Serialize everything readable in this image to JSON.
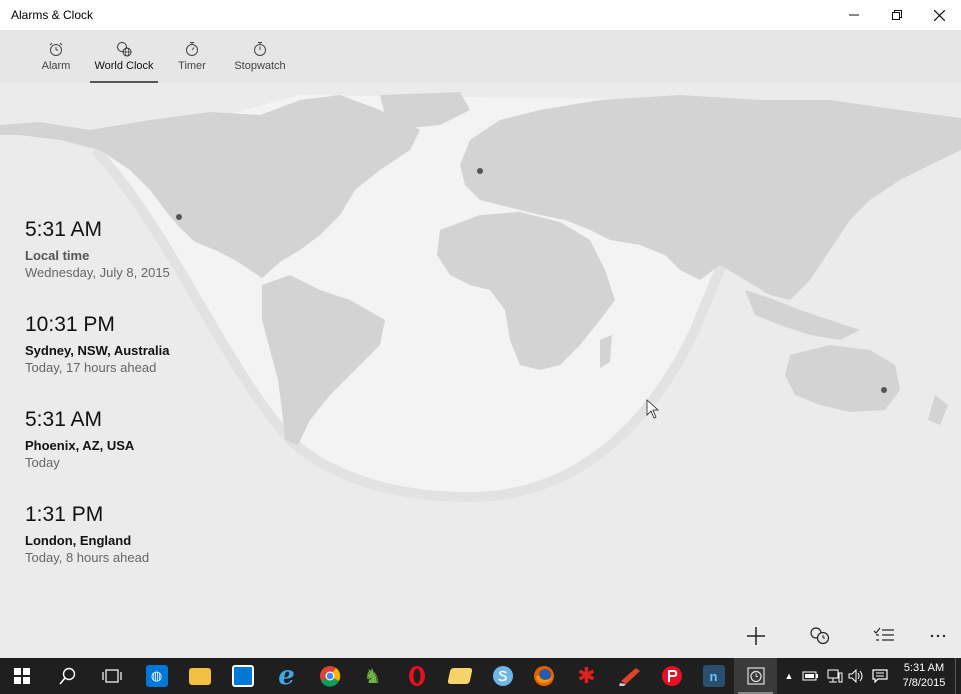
{
  "window": {
    "title": "Alarms & Clock",
    "minimize_icon": "minimize-icon",
    "restore_icon": "restore-icon",
    "close_icon": "close-icon"
  },
  "tabs": [
    {
      "label": "Alarm",
      "icon": "alarm-icon"
    },
    {
      "label": "World Clock",
      "icon": "world-clock-icon",
      "active": true
    },
    {
      "label": "Timer",
      "icon": "timer-icon"
    },
    {
      "label": "Stopwatch",
      "icon": "stopwatch-icon"
    }
  ],
  "clocks": [
    {
      "time": "5:31 AM",
      "place": "Local time",
      "sub": "Wednesday, July 8, 2015"
    },
    {
      "time": "10:31 PM",
      "place": "Sydney, NSW, Australia",
      "sub": "Today, 17 hours ahead"
    },
    {
      "time": "5:31 AM",
      "place": "Phoenix, AZ, USA",
      "sub": "Today"
    },
    {
      "time": "1:31 PM",
      "place": "London, England",
      "sub": "Today, 8 hours ahead"
    }
  ],
  "commands": [
    "add-icon",
    "compare-icon",
    "select-icon",
    "more-icon"
  ],
  "taskbar": {
    "clock_time": "5:31 AM",
    "clock_date": "7/8/2015",
    "accent": "#0078d7"
  }
}
